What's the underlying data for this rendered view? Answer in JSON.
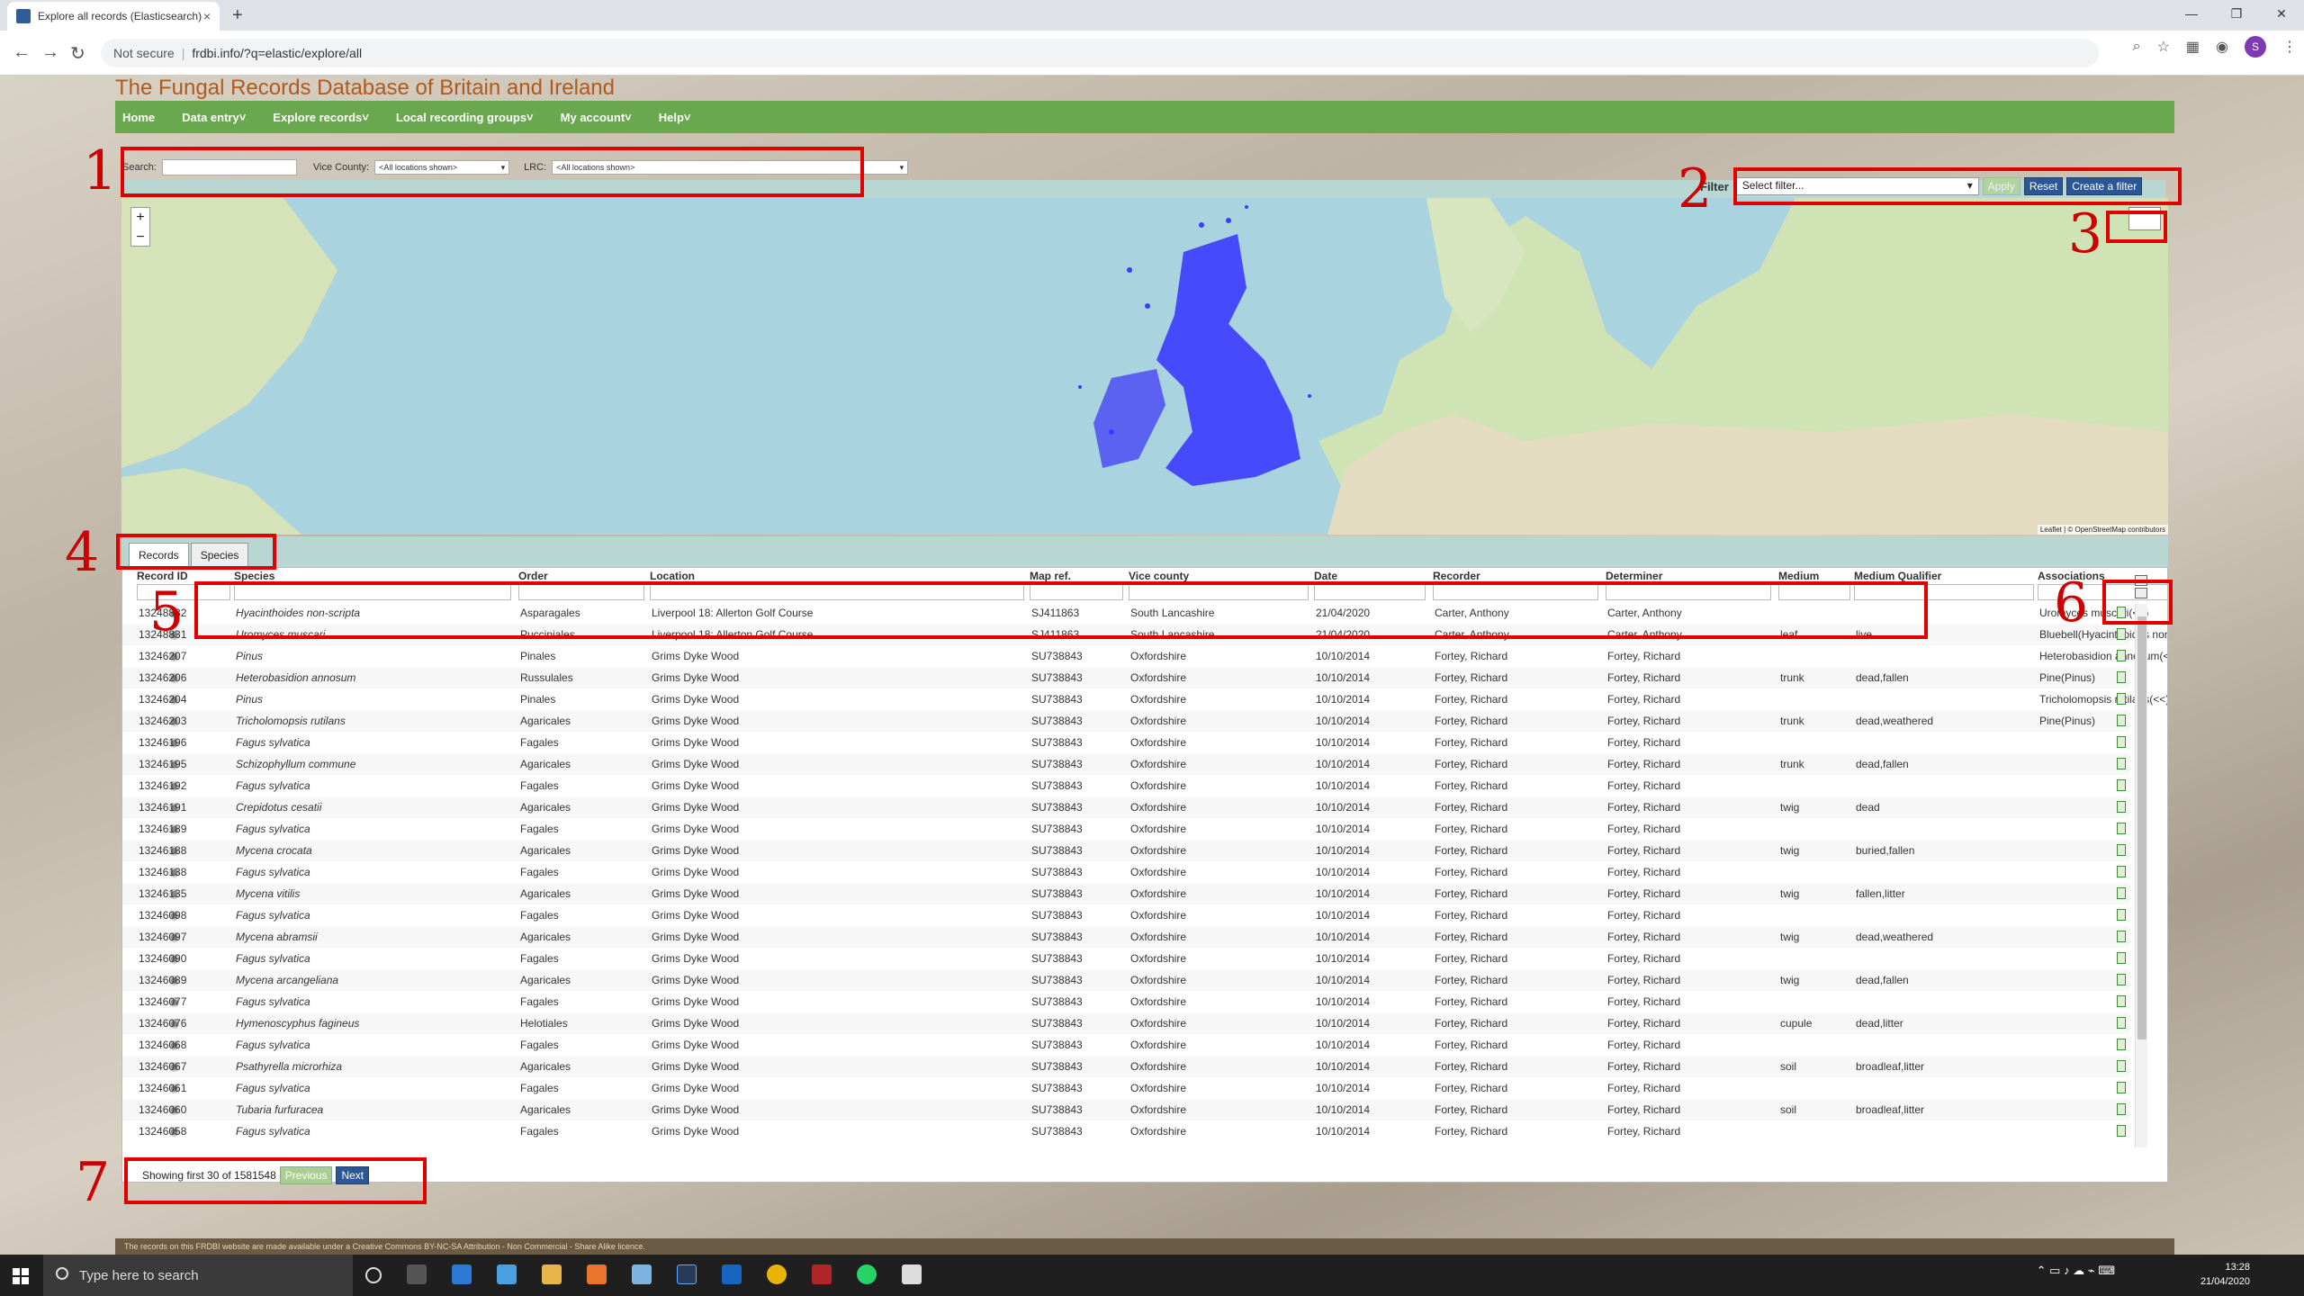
{
  "browser": {
    "tab_title": "Explore all records (Elasticsearch)",
    "tab_close": "×",
    "new_tab": "+",
    "not_secure": "Not secure",
    "url": "frdbi.info/?q=elastic/explore/all",
    "avatar_letter": "S"
  },
  "site": {
    "title": "The Fungal Records Database of Britain and Ireland",
    "menu": [
      "Home",
      "Data entry˅",
      "Explore records˅",
      "Local recording groups˅",
      "My account˅",
      "Help˅"
    ]
  },
  "filters": {
    "search_label": "Search:",
    "vice_county_label": "Vice County:",
    "vice_county_value": "<All locations shown>",
    "lrc_label": "LRC:",
    "lrc_value": "<All locations shown>",
    "filter_label": "Filter",
    "filter_select": "Select filter...",
    "apply": "Apply",
    "reset": "Reset",
    "create": "Create a filter"
  },
  "map": {
    "zoom_in": "+",
    "zoom_out": "−",
    "attribution": "Leaflet | © OpenStreetMap contributors"
  },
  "tabs": [
    "Records",
    "Species"
  ],
  "grid": {
    "columns": [
      "Record ID",
      "Species",
      "Order",
      "Location",
      "Map ref.",
      "Vice county",
      "Date",
      "Recorder",
      "Determiner",
      "Medium",
      "Medium Qualifier",
      "Associations"
    ],
    "rows": [
      [
        "13248832",
        "Hyacinthoides non-scripta",
        "Asparagales",
        "Liverpool 18: Allerton Golf Course",
        "SJ411863",
        "South Lancashire",
        "21/04/2020",
        "Carter, Anthony",
        "Carter, Anthony",
        "",
        "",
        "Uromyces muscari(<<)"
      ],
      [
        "13248831",
        "Uromyces muscari",
        "Pucciniales",
        "Liverpool 18: Allerton Golf Course",
        "SJ411863",
        "South Lancashire",
        "21/04/2020",
        "Carter, Anthony",
        "Carter, Anthony",
        "leaf",
        "live",
        "Bluebell(Hyacinthoides non-scripta)"
      ],
      [
        "13246207",
        "Pinus",
        "Pinales",
        "Grims Dyke Wood",
        "SU738843",
        "Oxfordshire",
        "10/10/2014",
        "Fortey, Richard",
        "Fortey, Richard",
        "",
        "",
        "Heterobasidion annosum(<<)"
      ],
      [
        "13246206",
        "Heterobasidion annosum",
        "Russulales",
        "Grims Dyke Wood",
        "SU738843",
        "Oxfordshire",
        "10/10/2014",
        "Fortey, Richard",
        "Fortey, Richard",
        "trunk",
        "dead,fallen",
        "Pine(Pinus)"
      ],
      [
        "13246204",
        "Pinus",
        "Pinales",
        "Grims Dyke Wood",
        "SU738843",
        "Oxfordshire",
        "10/10/2014",
        "Fortey, Richard",
        "Fortey, Richard",
        "",
        "",
        "Tricholomopsis rutilans(<<)"
      ],
      [
        "13246203",
        "Tricholomopsis rutilans",
        "Agaricales",
        "Grims Dyke Wood",
        "SU738843",
        "Oxfordshire",
        "10/10/2014",
        "Fortey, Richard",
        "Fortey, Richard",
        "trunk",
        "dead,weathered",
        "Pine(Pinus)"
      ],
      [
        "13246196",
        "Fagus sylvatica",
        "Fagales",
        "Grims Dyke Wood",
        "SU738843",
        "Oxfordshire",
        "10/10/2014",
        "Fortey, Richard",
        "Fortey, Richard",
        "",
        "",
        ""
      ],
      [
        "13246195",
        "Schizophyllum commune",
        "Agaricales",
        "Grims Dyke Wood",
        "SU738843",
        "Oxfordshire",
        "10/10/2014",
        "Fortey, Richard",
        "Fortey, Richard",
        "trunk",
        "dead,fallen",
        ""
      ],
      [
        "13246192",
        "Fagus sylvatica",
        "Fagales",
        "Grims Dyke Wood",
        "SU738843",
        "Oxfordshire",
        "10/10/2014",
        "Fortey, Richard",
        "Fortey, Richard",
        "",
        "",
        ""
      ],
      [
        "13246191",
        "Crepidotus cesatii",
        "Agaricales",
        "Grims Dyke Wood",
        "SU738843",
        "Oxfordshire",
        "10/10/2014",
        "Fortey, Richard",
        "Fortey, Richard",
        "twig",
        "dead",
        ""
      ],
      [
        "13246189",
        "Fagus sylvatica",
        "Fagales",
        "Grims Dyke Wood",
        "SU738843",
        "Oxfordshire",
        "10/10/2014",
        "Fortey, Richard",
        "Fortey, Richard",
        "",
        "",
        ""
      ],
      [
        "13246188",
        "Mycena crocata",
        "Agaricales",
        "Grims Dyke Wood",
        "SU738843",
        "Oxfordshire",
        "10/10/2014",
        "Fortey, Richard",
        "Fortey, Richard",
        "twig",
        "buried,fallen",
        ""
      ],
      [
        "13246138",
        "Fagus sylvatica",
        "Fagales",
        "Grims Dyke Wood",
        "SU738843",
        "Oxfordshire",
        "10/10/2014",
        "Fortey, Richard",
        "Fortey, Richard",
        "",
        "",
        ""
      ],
      [
        "13246135",
        "Mycena vitilis",
        "Agaricales",
        "Grims Dyke Wood",
        "SU738843",
        "Oxfordshire",
        "10/10/2014",
        "Fortey, Richard",
        "Fortey, Richard",
        "twig",
        "fallen,litter",
        ""
      ],
      [
        "13246098",
        "Fagus sylvatica",
        "Fagales",
        "Grims Dyke Wood",
        "SU738843",
        "Oxfordshire",
        "10/10/2014",
        "Fortey, Richard",
        "Fortey, Richard",
        "",
        "",
        ""
      ],
      [
        "13246097",
        "Mycena abramsii",
        "Agaricales",
        "Grims Dyke Wood",
        "SU738843",
        "Oxfordshire",
        "10/10/2014",
        "Fortey, Richard",
        "Fortey, Richard",
        "twig",
        "dead,weathered",
        ""
      ],
      [
        "13246090",
        "Fagus sylvatica",
        "Fagales",
        "Grims Dyke Wood",
        "SU738843",
        "Oxfordshire",
        "10/10/2014",
        "Fortey, Richard",
        "Fortey, Richard",
        "",
        "",
        ""
      ],
      [
        "13246089",
        "Mycena arcangeliana",
        "Agaricales",
        "Grims Dyke Wood",
        "SU738843",
        "Oxfordshire",
        "10/10/2014",
        "Fortey, Richard",
        "Fortey, Richard",
        "twig",
        "dead,fallen",
        ""
      ],
      [
        "13246077",
        "Fagus sylvatica",
        "Fagales",
        "Grims Dyke Wood",
        "SU738843",
        "Oxfordshire",
        "10/10/2014",
        "Fortey, Richard",
        "Fortey, Richard",
        "",
        "",
        ""
      ],
      [
        "13246076",
        "Hymenoscyphus fagineus",
        "Helotiales",
        "Grims Dyke Wood",
        "SU738843",
        "Oxfordshire",
        "10/10/2014",
        "Fortey, Richard",
        "Fortey, Richard",
        "cupule",
        "dead,litter",
        ""
      ],
      [
        "13246068",
        "Fagus sylvatica",
        "Fagales",
        "Grims Dyke Wood",
        "SU738843",
        "Oxfordshire",
        "10/10/2014",
        "Fortey, Richard",
        "Fortey, Richard",
        "",
        "",
        ""
      ],
      [
        "13246067",
        "Psathyrella microrhiza",
        "Agaricales",
        "Grims Dyke Wood",
        "SU738843",
        "Oxfordshire",
        "10/10/2014",
        "Fortey, Richard",
        "Fortey, Richard",
        "soil",
        "broadleaf,litter",
        ""
      ],
      [
        "13246061",
        "Fagus sylvatica",
        "Fagales",
        "Grims Dyke Wood",
        "SU738843",
        "Oxfordshire",
        "10/10/2014",
        "Fortey, Richard",
        "Fortey, Richard",
        "",
        "",
        ""
      ],
      [
        "13246060",
        "Tubaria furfuracea",
        "Agaricales",
        "Grims Dyke Wood",
        "SU738843",
        "Oxfordshire",
        "10/10/2014",
        "Fortey, Richard",
        "Fortey, Richard",
        "soil",
        "broadleaf,litter",
        ""
      ],
      [
        "13246058",
        "Fagus sylvatica",
        "Fagales",
        "Grims Dyke Wood",
        "SU738843",
        "Oxfordshire",
        "10/10/2014",
        "Fortey, Richard",
        "Fortey, Richard",
        "",
        "",
        ""
      ]
    ]
  },
  "pager": {
    "status": "Showing first 30 of 1581548",
    "previous": "Previous",
    "next": "Next"
  },
  "footer": "The records on this FRDBI website are made available under a Creative Commons BY-NC-SA Attribution - Non Commercial - Share Alike licence.",
  "annotations": [
    "1",
    "2",
    "3",
    "4",
    "5",
    "6",
    "7"
  ],
  "taskbar": {
    "search_placeholder": "Type here to search",
    "time": "13:28",
    "date": "21/04/2020"
  },
  "colors": {
    "menu_green": "#6aa84f",
    "title_orange": "#b05a1e",
    "button_blue": "#2b5797",
    "annotation_red": "#e00000",
    "record_dots": "#3b3bff"
  }
}
